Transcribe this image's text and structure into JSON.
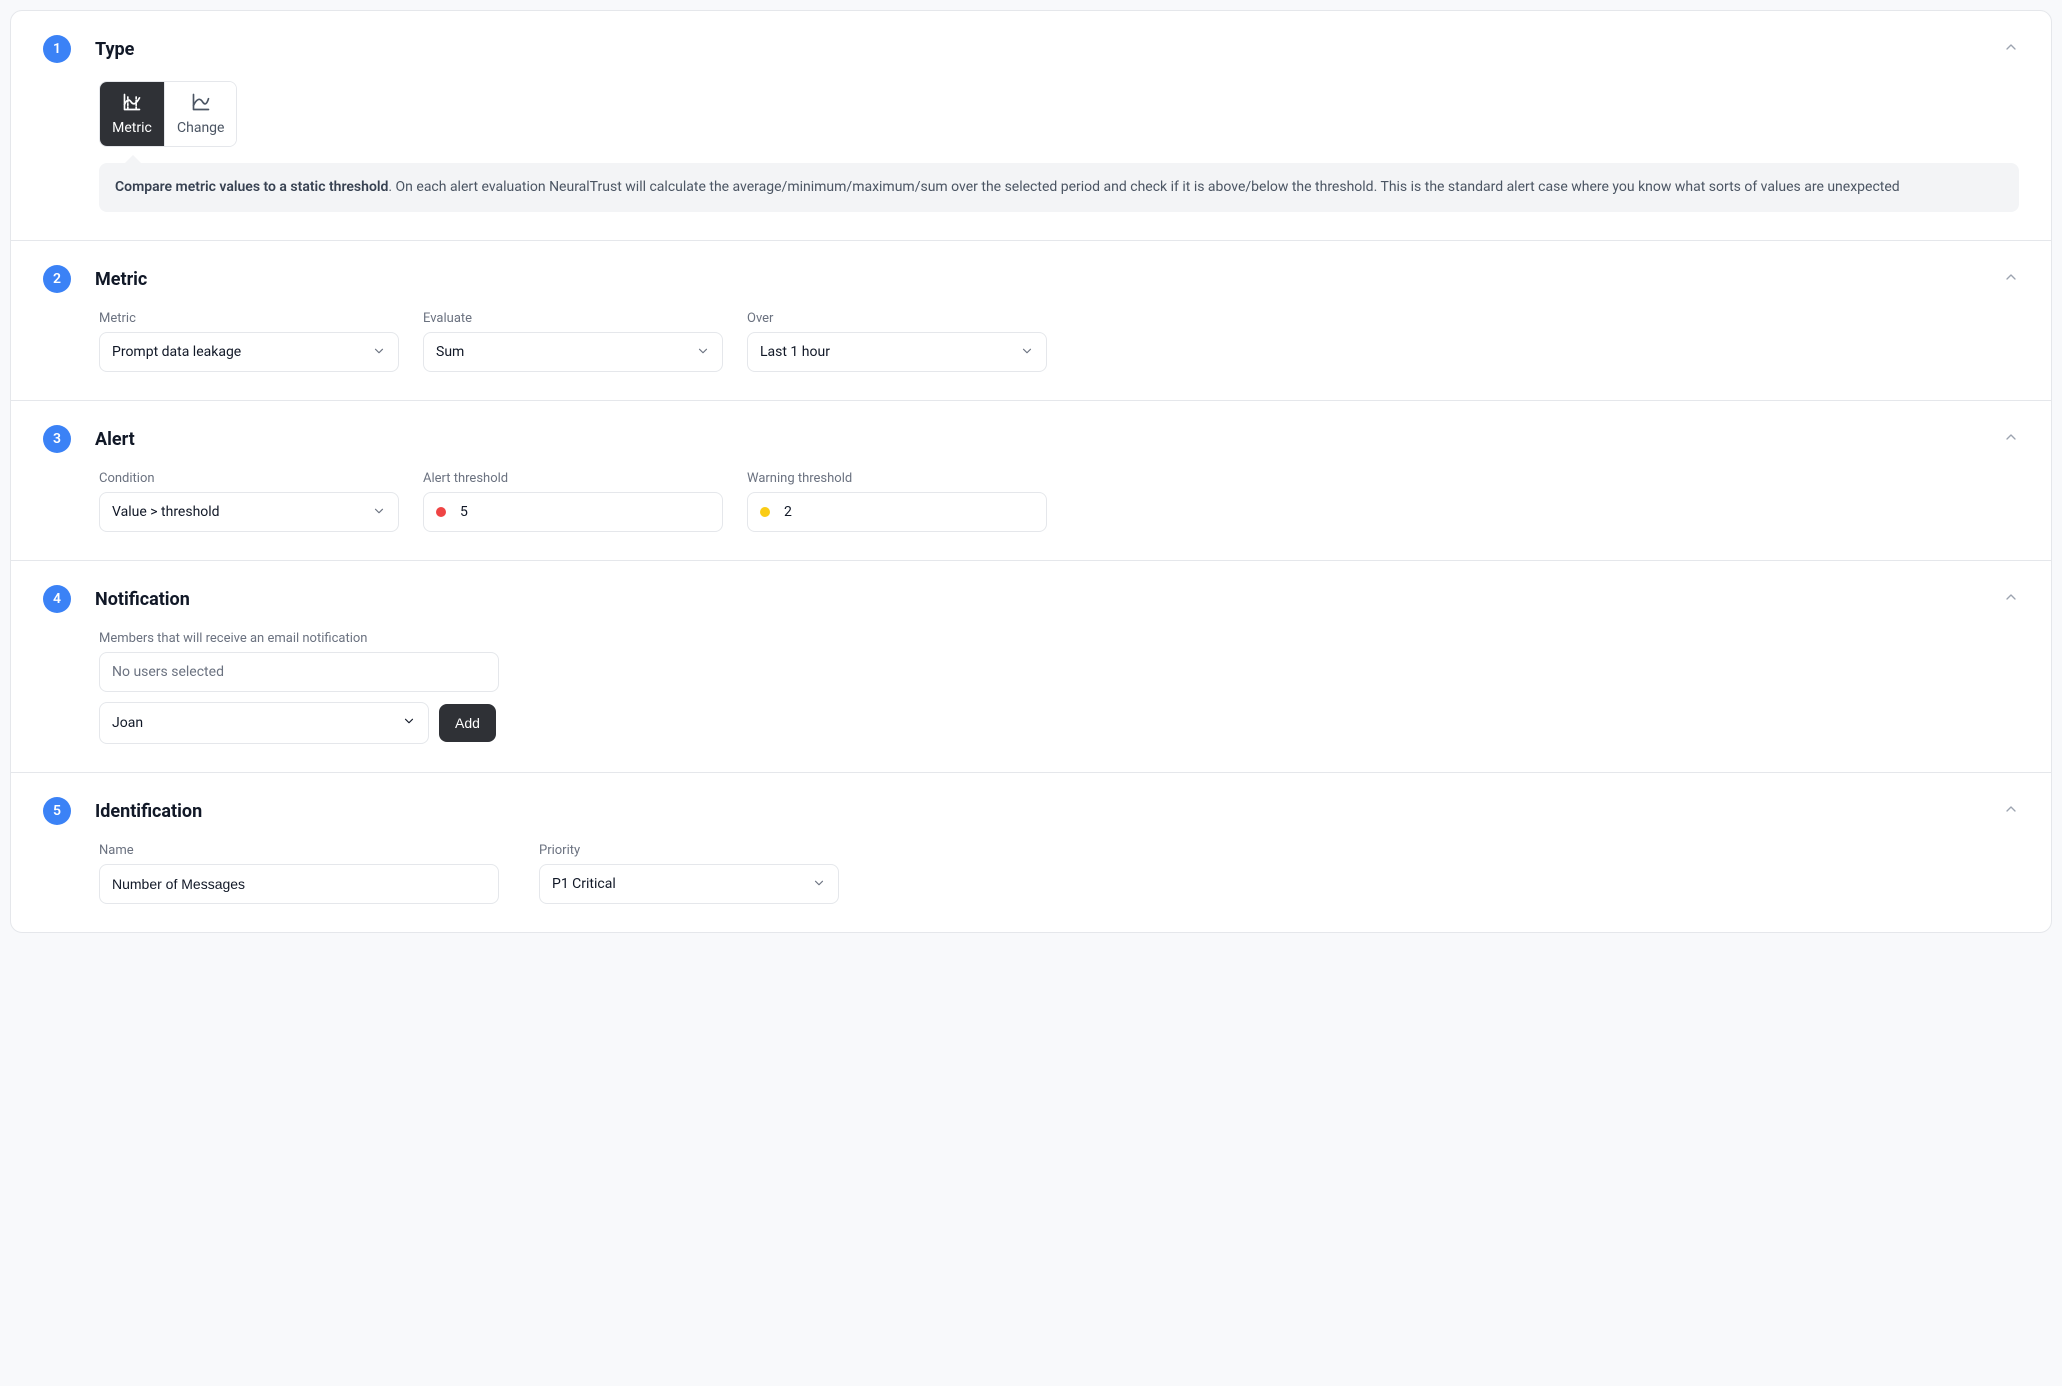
{
  "sections": {
    "type": {
      "step": "1",
      "title": "Type",
      "tabs": {
        "metric": "Metric",
        "change": "Change"
      },
      "info_bold": "Compare metric values to a static threshold",
      "info_rest": ". On each alert evaluation NeuralTrust will calculate the average/minimum/maximum/sum over the selected period and check if it is above/below the threshold. This is the standard alert case where you know what sorts of values are unexpected"
    },
    "metric": {
      "step": "2",
      "title": "Metric",
      "labels": {
        "metric": "Metric",
        "evaluate": "Evaluate",
        "over": "Over"
      },
      "values": {
        "metric": "Prompt data leakage",
        "evaluate": "Sum",
        "over": "Last 1 hour"
      }
    },
    "alert": {
      "step": "3",
      "title": "Alert",
      "labels": {
        "condition": "Condition",
        "alert_threshold": "Alert threshold",
        "warning_threshold": "Warning threshold"
      },
      "values": {
        "condition": "Value > threshold",
        "alert_threshold": "5",
        "warning_threshold": "2"
      }
    },
    "notification": {
      "step": "4",
      "title": "Notification",
      "hint": "Members that will receive an email notification",
      "selected_placeholder": "No users selected",
      "user_value": "Joan",
      "add_label": "Add"
    },
    "identification": {
      "step": "5",
      "title": "Identification",
      "labels": {
        "name": "Name",
        "priority": "Priority"
      },
      "values": {
        "name": "Number of Messages",
        "priority": "P1 Critical"
      }
    }
  }
}
